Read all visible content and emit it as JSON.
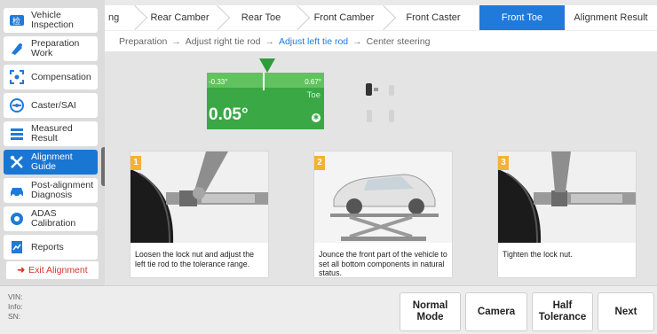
{
  "sidebar": {
    "items": [
      {
        "label": "Vehicle Inspection",
        "icon": "vehicle-inspection-icon"
      },
      {
        "label": "Preparation Work",
        "icon": "preparation-icon"
      },
      {
        "label": "Compensation",
        "icon": "compensation-icon"
      },
      {
        "label": "Caster/SAI",
        "icon": "caster-icon"
      },
      {
        "label": "Measured Result",
        "icon": "measured-result-icon"
      },
      {
        "label": "Alignment Guide",
        "icon": "tools-icon"
      },
      {
        "label": "Post-alignment Diagnosis",
        "icon": "car-icon"
      },
      {
        "label": "ADAS Calibration",
        "icon": "adas-icon"
      },
      {
        "label": "Reports",
        "icon": "reports-icon"
      }
    ],
    "exit_label": "Exit Alignment"
  },
  "tabs": [
    "ng",
    "Rear Camber",
    "Rear Toe",
    "Front Camber",
    "Front Caster",
    "Front Toe",
    "Alignment Result"
  ],
  "active_tab": "Front Toe",
  "breadcrumb": {
    "items": [
      "Preparation",
      "Adjust right tie rod",
      "Adjust left tie rod",
      "Center steering"
    ],
    "current": "Adjust left tie rod",
    "arrow": "→"
  },
  "gauge": {
    "min_label": "-0.33°",
    "max_label": "0.67°",
    "name": "Toe",
    "value": "0.05°"
  },
  "steps": [
    {
      "number": "1",
      "text": "Loosen the lock nut and adjust the left tie rod to the tolerance range."
    },
    {
      "number": "2",
      "text": "Jounce the front part of the vehicle to set all bottom components in natural status."
    },
    {
      "number": "3",
      "text": "Tighten the lock nut."
    }
  ],
  "info": {
    "vin": "VIN:",
    "info": "Info:",
    "sn": "SN:"
  },
  "buttons": {
    "normal_mode": "Normal Mode",
    "camera": "Camera",
    "half_tolerance": "Half Tolerance",
    "next": "Next"
  },
  "colors": {
    "accent": "#1f7ad9",
    "gauge_green": "#3aa845",
    "exit_red": "#d9342b",
    "step_badge": "#f2b233"
  }
}
